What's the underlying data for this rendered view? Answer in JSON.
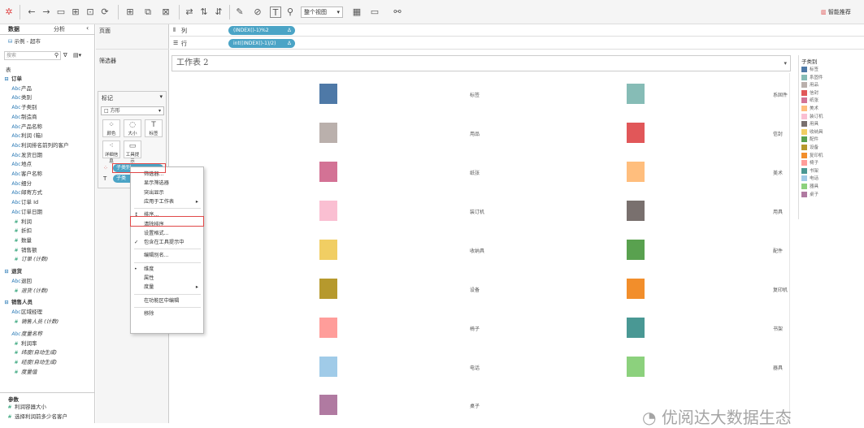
{
  "toolbar": {
    "view_select": "整个视图",
    "show_me": "智能推荐"
  },
  "left_pane": {
    "tabs": [
      "数据",
      "分析"
    ],
    "datasource": "示例 - 超市",
    "search_placeholder": "搜索",
    "section_table": "表",
    "rows": [
      {
        "t": "订单",
        "k": "hdr"
      },
      {
        "t": "产品",
        "k": "dim"
      },
      {
        "t": "类别",
        "k": "dim"
      },
      {
        "t": "子类别",
        "k": "dim"
      },
      {
        "t": "制造商",
        "k": "dim"
      },
      {
        "t": "产品名称",
        "k": "dim"
      },
      {
        "t": "利润 (箱)",
        "k": "dim"
      },
      {
        "t": "利润排名前列的客户",
        "k": "dim"
      },
      {
        "t": "发货日期",
        "k": "dim"
      },
      {
        "t": "地点",
        "k": "dim"
      },
      {
        "t": "客户名称",
        "k": "dim"
      },
      {
        "t": "细分",
        "k": "dim"
      },
      {
        "t": "邮寄方式",
        "k": "dim"
      },
      {
        "t": "订单 Id",
        "k": "dim"
      },
      {
        "t": "订单日期",
        "k": "dim"
      },
      {
        "t": "利润",
        "k": "meas"
      },
      {
        "t": "折扣",
        "k": "meas"
      },
      {
        "t": "数量",
        "k": "meas"
      },
      {
        "t": "销售额",
        "k": "meas"
      },
      {
        "t": "订单 (计数)",
        "k": "meas-i"
      },
      {
        "t": "退货",
        "k": "hdr"
      },
      {
        "t": "退回",
        "k": "dim"
      },
      {
        "t": "退货 (计数)",
        "k": "meas-i"
      },
      {
        "t": "销售人员",
        "k": "hdr"
      },
      {
        "t": "区域经理",
        "k": "dim"
      },
      {
        "t": "销售人员 (计数)",
        "k": "meas-i"
      },
      {
        "t": "度量名称",
        "k": "dim-i"
      },
      {
        "t": "利润率",
        "k": "meas"
      },
      {
        "t": "纬度(自动生成)",
        "k": "meas-i"
      },
      {
        "t": "经度(自动生成)",
        "k": "meas-i"
      },
      {
        "t": "度量值",
        "k": "meas-i"
      }
    ],
    "params_title": "参数",
    "params": [
      "利润容器大小",
      "选择利润前多少名客户"
    ]
  },
  "mid_pane": {
    "pages": "页面",
    "filters": "筛选器",
    "marks": "标记",
    "mark_type": "方形",
    "buttons": [
      "颜色",
      "大小",
      "标签",
      "详细信息",
      "工具提示"
    ],
    "color_pill": "子类别",
    "label_pill": "子类"
  },
  "shelves": {
    "columns_label": "列",
    "rows_label": "行",
    "columns_pill": "(INDEX()-1)%2",
    "rows_pill": "int((INDEX()-1)/2)"
  },
  "sheet": {
    "title": "工作表 2",
    "left_labels": [
      "标签",
      "用品",
      "纸张",
      "装订机",
      "收纳具",
      "设备",
      "椅子",
      "电话",
      "桌子"
    ],
    "left_colors": [
      "#4e79a7",
      "#bab0ac",
      "#d37295",
      "#fabfd2",
      "#f1ce63",
      "#b6992d",
      "#ff9d9a",
      "#a0cbe8",
      "#b07aa1"
    ],
    "right_labels": [
      "系固件",
      "信封",
      "美术",
      "用具",
      "配件",
      "复印机",
      "书架",
      "器具"
    ],
    "right_colors": [
      "#86bcb6",
      "#e15759",
      "#ffbe7d",
      "#79706e",
      "#59a14f",
      "#f28e2b",
      "#499894",
      "#8cd17d"
    ]
  },
  "legend": {
    "title": "子类别",
    "items": [
      {
        "label": "标签",
        "color": "#4e79a7"
      },
      {
        "label": "系固件",
        "color": "#86bcb6"
      },
      {
        "label": "用品",
        "color": "#bab0ac"
      },
      {
        "label": "信封",
        "color": "#e15759"
      },
      {
        "label": "纸张",
        "color": "#d37295"
      },
      {
        "label": "美术",
        "color": "#ffbe7d"
      },
      {
        "label": "装订机",
        "color": "#fabfd2"
      },
      {
        "label": "用具",
        "color": "#79706e"
      },
      {
        "label": "收纳具",
        "color": "#f1ce63"
      },
      {
        "label": "配件",
        "color": "#59a14f"
      },
      {
        "label": "设备",
        "color": "#b6992d"
      },
      {
        "label": "复印机",
        "color": "#f28e2b"
      },
      {
        "label": "椅子",
        "color": "#ff9d9a"
      },
      {
        "label": "书架",
        "color": "#499894"
      },
      {
        "label": "电话",
        "color": "#a0cbe8"
      },
      {
        "label": "器具",
        "color": "#8cd17d"
      },
      {
        "label": "桌子",
        "color": "#b07aa1"
      }
    ]
  },
  "context_menu": {
    "items": [
      {
        "t": "筛选器...",
        "sub": false,
        "chk": ""
      },
      {
        "t": "显示筛选器",
        "sub": false,
        "chk": ""
      },
      {
        "t": "突出显示",
        "sub": false,
        "chk": ""
      },
      {
        "t": "应用于工作表",
        "sub": true,
        "chk": ""
      },
      {
        "t": "---"
      },
      {
        "t": "排序...",
        "sub": false,
        "chk": ""
      },
      {
        "t": "清除排序",
        "sub": false,
        "chk": ""
      },
      {
        "t": "设置格式...",
        "sub": false,
        "chk": ""
      },
      {
        "t": "包含在工具提示中",
        "sub": false,
        "chk": "✓"
      },
      {
        "t": "---"
      },
      {
        "t": "编辑别名...",
        "sub": false,
        "chk": ""
      },
      {
        "t": "---"
      },
      {
        "t": "维度",
        "sub": false,
        "chk": "•"
      },
      {
        "t": "属性",
        "sub": false,
        "chk": ""
      },
      {
        "t": "度量",
        "sub": true,
        "chk": ""
      },
      {
        "t": "---"
      },
      {
        "t": "在功能区中编辑",
        "sub": false,
        "chk": ""
      },
      {
        "t": "---"
      },
      {
        "t": "移除",
        "sub": false,
        "chk": ""
      }
    ]
  },
  "watermark": "优阅达大数据生态"
}
